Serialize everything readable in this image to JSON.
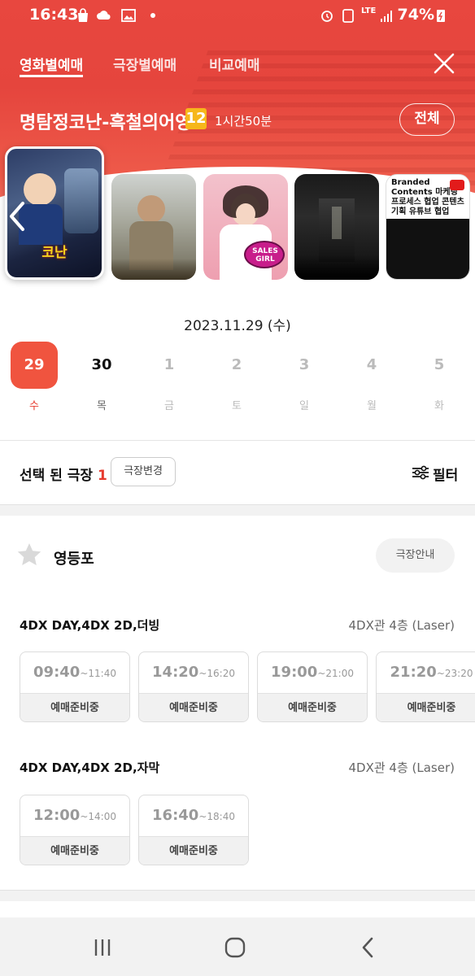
{
  "status_bar": {
    "time": "16:43",
    "battery": "74%",
    "network": "LTE"
  },
  "tabs": [
    {
      "label": "영화별예매",
      "active": true
    },
    {
      "label": "극장별예매",
      "active": false
    },
    {
      "label": "비교예매",
      "active": false
    }
  ],
  "movie": {
    "title": "명탐정코난-흑철의어영",
    "rating": "12",
    "runtime": "1시간50분",
    "all_button": "전체"
  },
  "posters": [
    {
      "caption": "코난",
      "selected": true
    },
    {
      "caption": "",
      "selected": false
    },
    {
      "caption": "SALES GIRL",
      "selected": false
    },
    {
      "caption": "",
      "selected": false
    },
    {
      "caption": "Branded Contents 마케팅 프로세스 협업 콘텐츠기획 유튜브 협업",
      "selected": false
    }
  ],
  "date_label": "2023.11.29 (수)",
  "days": [
    {
      "num": "29",
      "weekday": "수",
      "state": "active"
    },
    {
      "num": "30",
      "weekday": "목",
      "state": "dark"
    },
    {
      "num": "1",
      "weekday": "금",
      "state": "muted"
    },
    {
      "num": "2",
      "weekday": "토",
      "state": "muted"
    },
    {
      "num": "3",
      "weekday": "일",
      "state": "muted"
    },
    {
      "num": "4",
      "weekday": "월",
      "state": "muted"
    },
    {
      "num": "5",
      "weekday": "화",
      "state": "muted"
    }
  ],
  "selection": {
    "label": "선택 된 극장",
    "count": "1",
    "change_button": "극장변경",
    "filter_label": "필터"
  },
  "theater": {
    "name": "영등포",
    "guide_button": "극장안내"
  },
  "showings": [
    {
      "format": "4DX DAY,4DX 2D,더빙",
      "hall": "4DX관 4층 (Laser)",
      "slots": [
        {
          "start": "09:40",
          "end": "~11:40",
          "status": "예매준비중"
        },
        {
          "start": "14:20",
          "end": "~16:20",
          "status": "예매준비중"
        },
        {
          "start": "19:00",
          "end": "~21:00",
          "status": "예매준비중"
        },
        {
          "start": "21:20",
          "end": "~23:20",
          "status": "예매준비중"
        }
      ]
    },
    {
      "format": "4DX DAY,4DX 2D,자막",
      "hall": "4DX관 4층 (Laser)",
      "slots": [
        {
          "start": "12:00",
          "end": "~14:00",
          "status": "예매준비중"
        },
        {
          "start": "16:40",
          "end": "~18:40",
          "status": "예매준비중"
        }
      ]
    }
  ],
  "colors": {
    "brand_red": "#e8473f",
    "accent_red": "#f0543f",
    "rating_yellow": "#f6b71b"
  }
}
